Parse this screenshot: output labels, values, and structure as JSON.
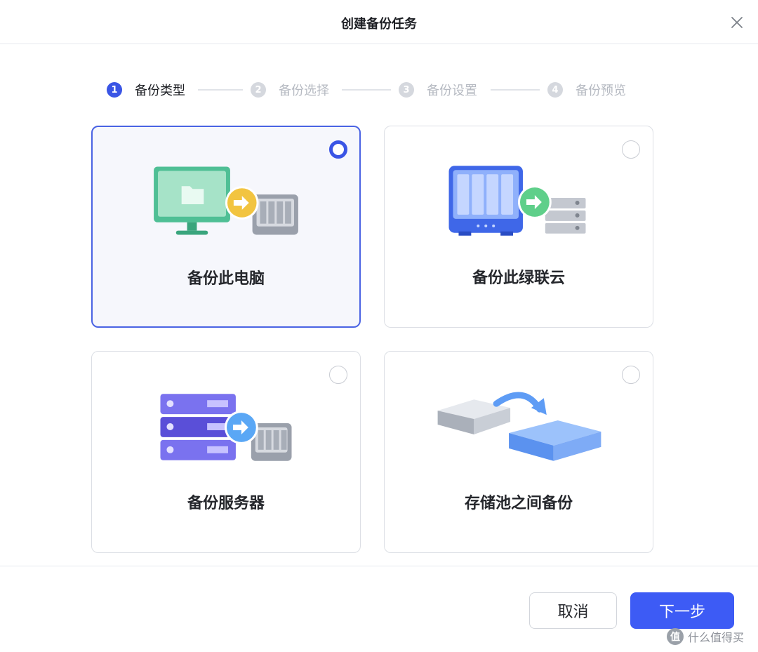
{
  "dialog": {
    "title": "创建备份任务",
    "close_icon": "close-icon"
  },
  "steps": [
    {
      "num": "1",
      "label": "备份类型",
      "state": "active"
    },
    {
      "num": "2",
      "label": "备份选择",
      "state": "inactive"
    },
    {
      "num": "3",
      "label": "备份设置",
      "state": "inactive"
    },
    {
      "num": "4",
      "label": "备份预览",
      "state": "inactive"
    }
  ],
  "options": [
    {
      "label": "备份此电脑",
      "icon": "computer-to-nas-icon",
      "selected": true
    },
    {
      "label": "备份此绿联云",
      "icon": "nas-to-server-icon",
      "selected": false
    },
    {
      "label": "备份服务器",
      "icon": "server-to-nas-icon",
      "selected": false
    },
    {
      "label": "存储池之间备份",
      "icon": "storage-pool-transfer-icon",
      "selected": false
    }
  ],
  "footer": {
    "cancel_label": "取消",
    "next_label": "下一步"
  },
  "watermark": {
    "text": "什么值得买",
    "icon_char": "值"
  },
  "colors": {
    "accent": "#3a55e5",
    "button_primary": "#3d5bf5",
    "step_inactive": "#d5d8de",
    "border": "#dcdfe5"
  }
}
